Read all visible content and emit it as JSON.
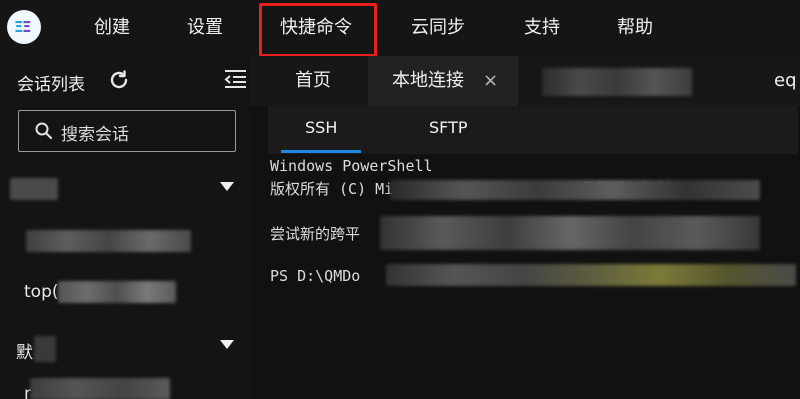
{
  "menu": {
    "items": [
      {
        "label": "创建"
      },
      {
        "label": "设置"
      },
      {
        "label": "快捷命令",
        "highlighted": true
      },
      {
        "label": "云同步"
      },
      {
        "label": "支持"
      },
      {
        "label": "帮助"
      }
    ],
    "highlight_color": "#e8201e"
  },
  "sidebar": {
    "title": "会话列表",
    "search_placeholder": "搜索会话",
    "sessions": [
      {
        "label": "top("
      },
      {
        "label": "r"
      }
    ],
    "groups": [
      {
        "label": "默"
      }
    ]
  },
  "tabs": {
    "home": "首页",
    "active": "本地连接",
    "close_glyph": "×",
    "partial": "eq"
  },
  "subtabs": {
    "ssh": "SSH",
    "sftp": "SFTP",
    "accent": "#1e88e5"
  },
  "terminal": {
    "lines": [
      "Windows PowerShell",
      "版权所有 (C) Microsoft Corporation。保留所有权利。",
      "尝试新的跨平",
      "PS D:\\QMDo"
    ]
  }
}
